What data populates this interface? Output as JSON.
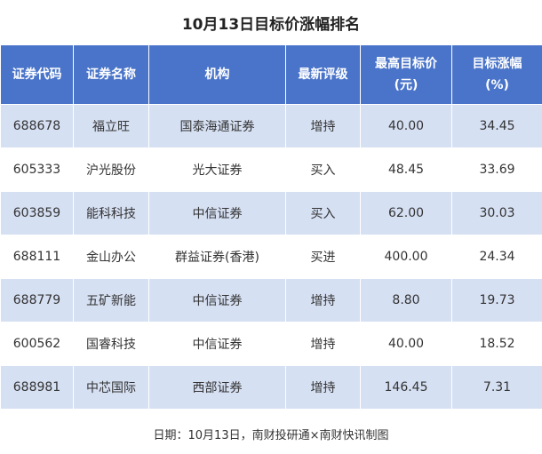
{
  "title": "10月13日目标价涨幅排名",
  "headers": [
    [
      "证券代码"
    ],
    [
      "证券名称"
    ],
    [
      "机构"
    ],
    [
      "最新评级"
    ],
    [
      "最高目标价",
      "(元)"
    ],
    [
      "目标涨幅",
      "(%)"
    ]
  ],
  "rows": [
    [
      "688678",
      "福立旺",
      "国泰海通证券",
      "增持",
      "40.00",
      "34.45"
    ],
    [
      "605333",
      "沪光股份",
      "光大证券",
      "买入",
      "48.45",
      "33.69"
    ],
    [
      "603859",
      "能科科技",
      "中信证券",
      "买入",
      "62.00",
      "30.03"
    ],
    [
      "688111",
      "金山办公",
      "群益证券(香港)",
      "买进",
      "400.00",
      "24.34"
    ],
    [
      "688779",
      "五矿新能",
      "中信证券",
      "增持",
      "8.80",
      "19.73"
    ],
    [
      "600562",
      "国睿科技",
      "中信证券",
      "增持",
      "40.00",
      "18.52"
    ],
    [
      "688981",
      "中芯国际",
      "西部证券",
      "增持",
      "146.45",
      "7.31"
    ]
  ],
  "footer": "日期：10月13日，南财投研通×南财快讯制图",
  "colors": {
    "header_bg": "#4a74c9",
    "stripe_bg": "#d6e0f3"
  }
}
